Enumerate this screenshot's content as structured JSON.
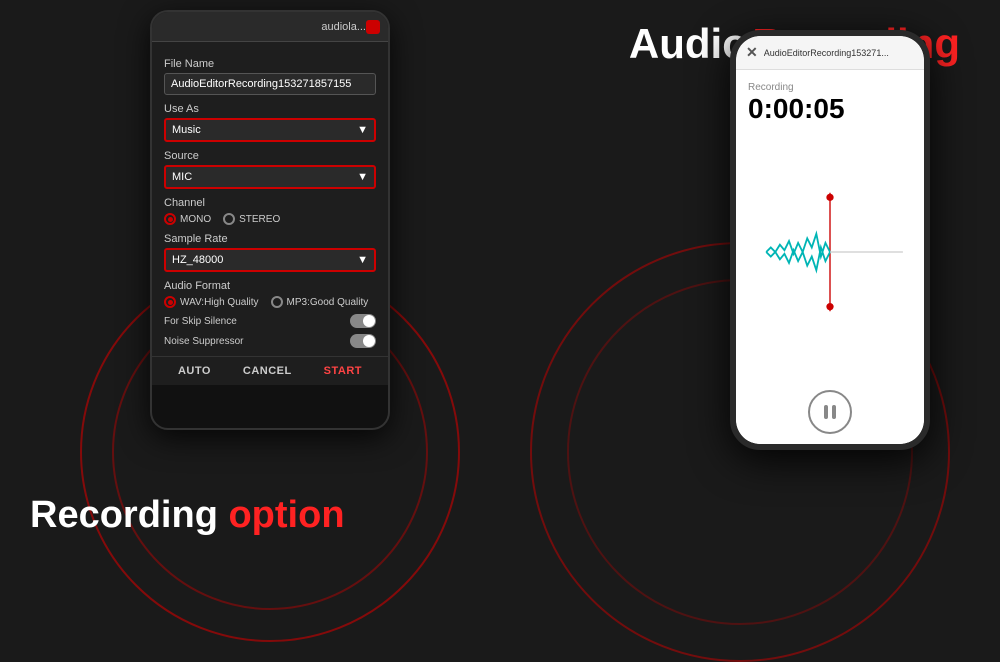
{
  "title": {
    "audio": "Audio",
    "recording": "Recording"
  },
  "bottom_title": {
    "recording": "Recording",
    "option": "option"
  },
  "left_phone": {
    "top_bar": {
      "label": "audiola..."
    },
    "dialog": {
      "file_name_label": "File Name",
      "file_name_value": "AudioEditorRecording153271857155",
      "use_as_label": "Use As",
      "use_as_value": "Music",
      "source_label": "Source",
      "source_value": "MIC",
      "channel_label": "Channel",
      "channel_mono": "MONO",
      "channel_stereo": "STEREO",
      "sample_rate_label": "Sample Rate",
      "sample_rate_value": "HZ_48000",
      "audio_format_label": "Audio Format",
      "audio_format_wav": "WAV:High Quality",
      "audio_format_mp3": "MP3:Good Quality",
      "for_skip_silence_label": "For Skip Silence",
      "noise_suppressor_label": "Noise Suppressor",
      "btn_auto": "AUTO",
      "btn_cancel": "CANCEL",
      "btn_start": "START"
    }
  },
  "right_phone": {
    "header": {
      "title": "AudioEditorRecording153271..."
    },
    "recording_label": "Recording",
    "timer": "0:00:05"
  },
  "colors": {
    "accent": "#cc0000",
    "background": "#1a1a1a",
    "text_white": "#ffffff",
    "text_red": "#ff2222"
  }
}
